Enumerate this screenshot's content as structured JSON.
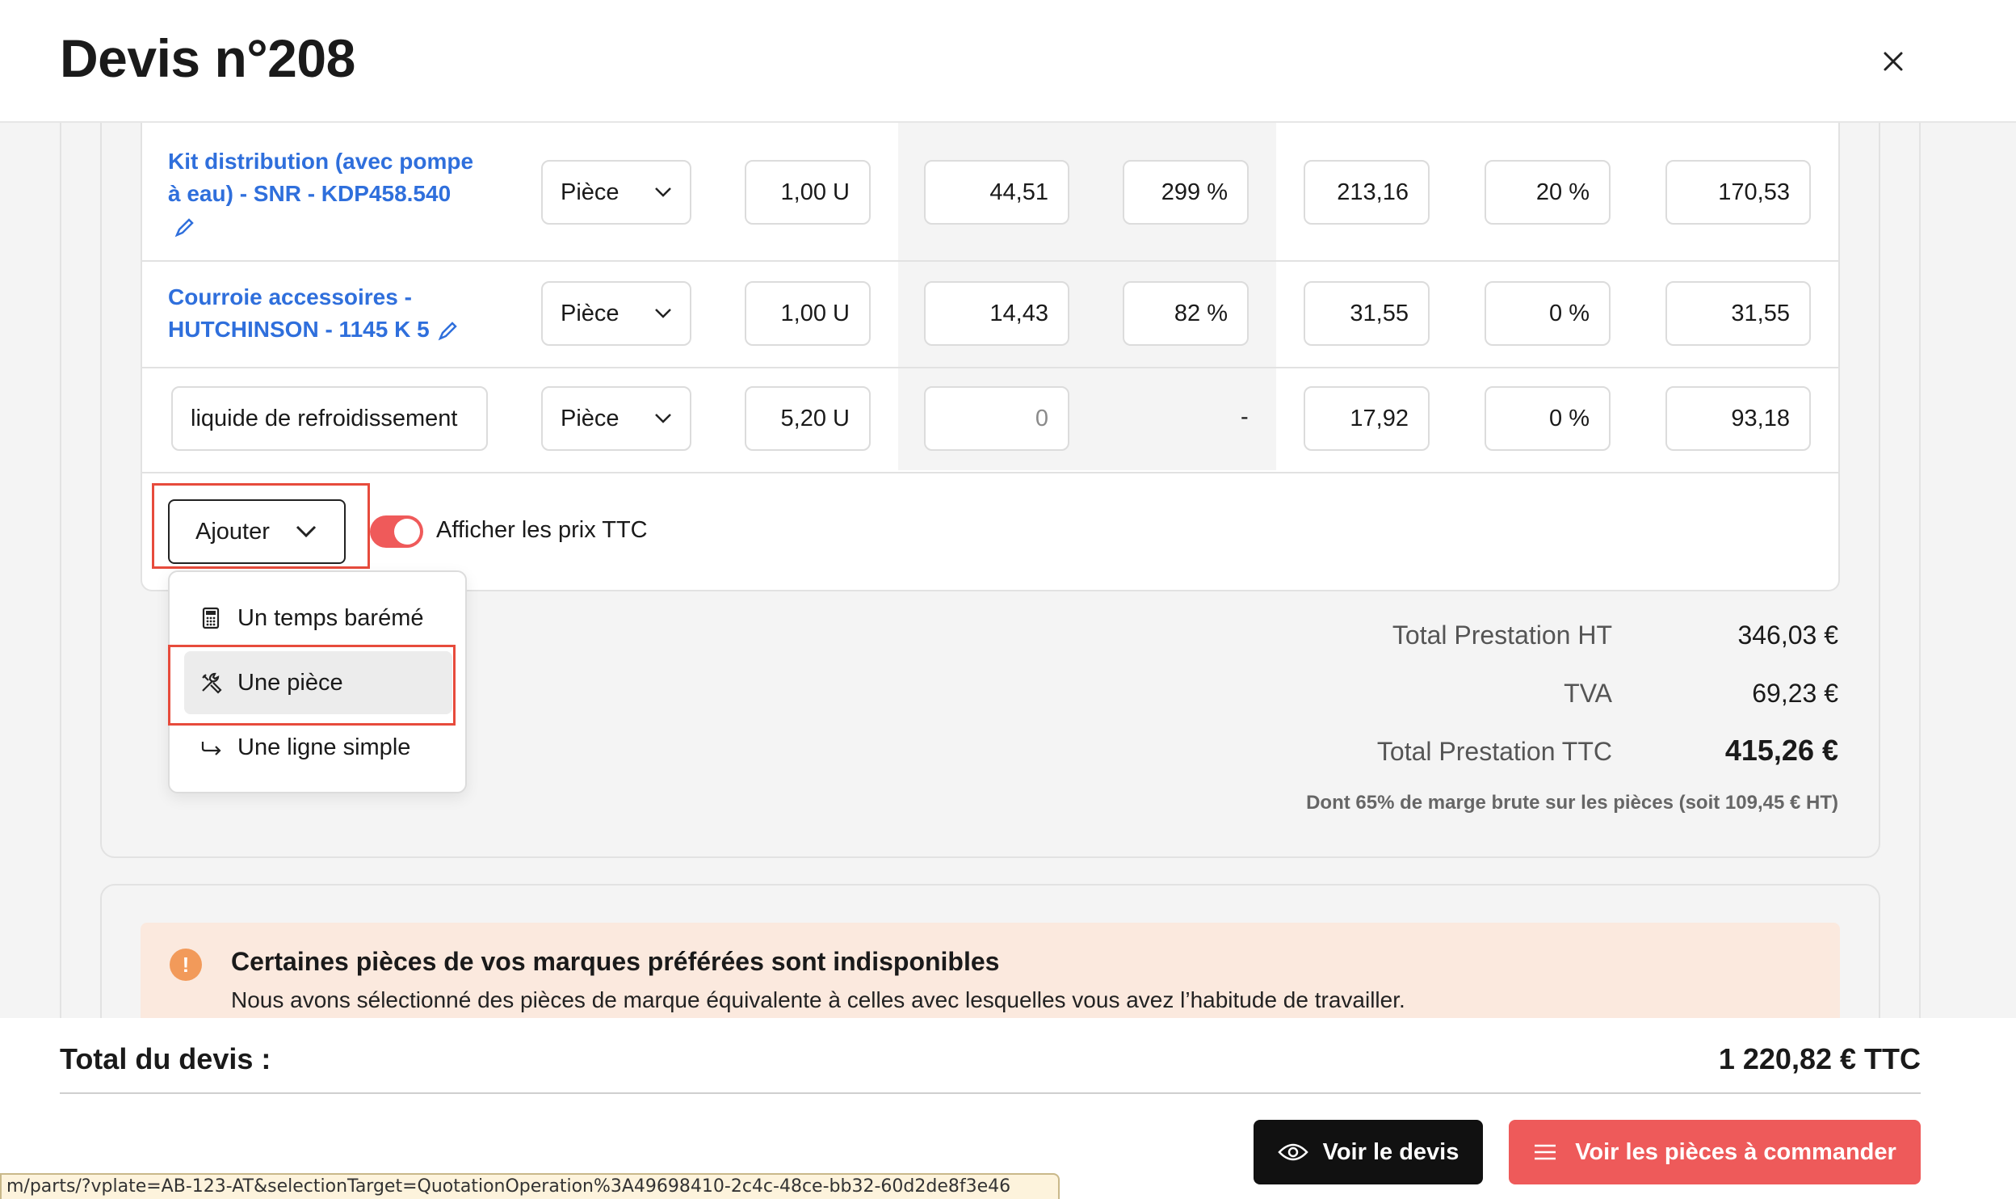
{
  "header": {
    "title": "Devis n°208"
  },
  "table": {
    "rows": [
      {
        "name": "Kit distribution (avec pompe à eau) - SNR - KDP458.540",
        "name_lines": [
          "Kit distribution (avec pompe",
          "à eau) - SNR - KDP458.540"
        ],
        "unit_type": "Pièce",
        "quantity": "1,00 U",
        "purchase_price": "44,51",
        "margin": "299 %",
        "unit_price": "213,16",
        "vat": "20 %",
        "total": "170,53"
      },
      {
        "name": "Courroie accessoires - HUTCHINSON - 1145 K 5",
        "name_lines": [
          "Courroie accessoires -",
          "HUTCHINSON - 1145 K 5"
        ],
        "unit_type": "Pièce",
        "quantity": "1,00 U",
        "purchase_price": "14,43",
        "margin": "82 %",
        "unit_price": "31,55",
        "vat": "0 %",
        "total": "31,55"
      },
      {
        "name": "liquide de refroidissement",
        "unit_type": "Pièce",
        "quantity": "5,20 U",
        "purchase_price": "0",
        "margin": "-",
        "unit_price": "17,92",
        "vat": "0 %",
        "total": "93,18"
      }
    ]
  },
  "actions": {
    "add_label": "Ajouter",
    "toggle_label": "Afficher les prix TTC",
    "toggle_on": true
  },
  "add_menu": {
    "items": [
      {
        "label": "Un temps barémé",
        "icon": "calculator-icon"
      },
      {
        "label": "Une pièce",
        "icon": "tools-icon",
        "active": true
      },
      {
        "label": "Une ligne simple",
        "icon": "arrow-return-icon"
      }
    ]
  },
  "totals": {
    "ht_label": "Total Prestation HT",
    "ht_value": "346,03 €",
    "tva_label": "TVA",
    "tva_value": "69,23 €",
    "ttc_label": "Total Prestation TTC",
    "ttc_value": "415,26 €",
    "margin_note": "Dont 65% de marge brute sur les pièces (soit 109,45 € HT)"
  },
  "alert": {
    "title": "Certaines pièces de vos marques préférées sont indisponibles",
    "text": "Nous avons sélectionné des pièces de marque équivalente à celles avec lesquelles vous avez l’habitude de travailler."
  },
  "footer": {
    "total_label": "Total du devis :",
    "total_value": "1 220,82 € TTC",
    "view_quote": "Voir le devis",
    "view_parts": "Voir les pièces à commander"
  },
  "status_url": "m/parts/?vplate=AB-123-AT&selectionTarget=QuotationOperation%3A49698410-2c4c-48ce-bb32-60d2de8f3e46",
  "colors": {
    "link": "#2f6fdc",
    "accent": "#ee5a5a",
    "alert_bg": "#fbe9de",
    "highlight": "#e74b3c"
  }
}
